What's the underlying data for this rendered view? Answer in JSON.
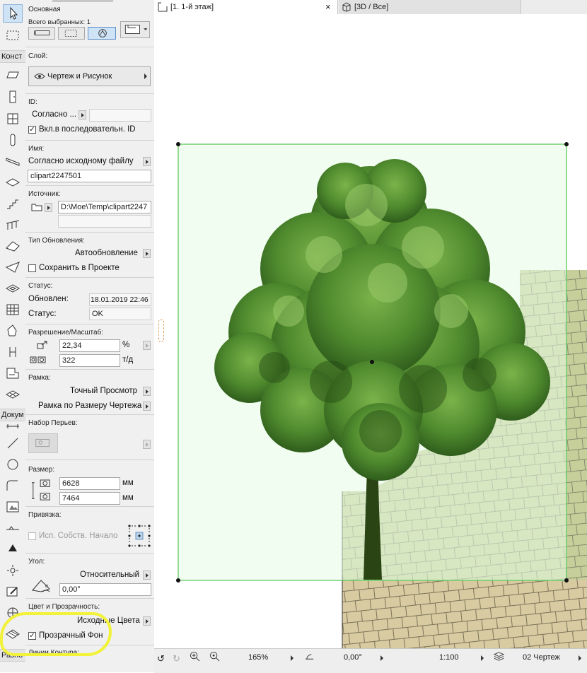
{
  "toolbox": {
    "header_construct": "Конст",
    "header_document": "Докум",
    "header_misc": "Разно"
  },
  "panel": {
    "main_label": "Основная",
    "selected_count": "Всего выбранных: 1",
    "layer": {
      "label": "Слой:",
      "value": "Чертеж и Рисунок"
    },
    "id": {
      "label": "ID:",
      "mode": "Согласно ...",
      "value": "",
      "sequential_label": "Вкл.в последовательн. ID",
      "sequential_checked": true
    },
    "name": {
      "label": "Имя:",
      "mode": "Согласно исходному файлу",
      "value": "clipart2247501"
    },
    "source": {
      "label": "Источник:",
      "path": "D:\\Moe\\Temp\\clipart2247"
    },
    "update": {
      "label": "Тип Обновления:",
      "mode": "Автообновление",
      "save_label": "Сохранить в Проекте",
      "save_checked": false
    },
    "status": {
      "label": "Статус:",
      "updated_label": "Обновлен:",
      "updated_value": "18.01.2019 22:46",
      "status_label": "Статус:",
      "status_value": "OK"
    },
    "resolution": {
      "label": "Разрешение/Масштаб:",
      "percent": "22,34",
      "percent_unit": "%",
      "dpi": "322",
      "dpi_unit": "т/д"
    },
    "frame": {
      "label": "Рамка:",
      "view": "Точный Просмотр",
      "fit": "Рамка по Размеру Чертежа"
    },
    "pen_set": {
      "label": "Набор Перьев:"
    },
    "size": {
      "label": "Размер:",
      "width": "6628",
      "width_unit": "мм",
      "height": "7464",
      "height_unit": "мм"
    },
    "anchor": {
      "label": "Привязка:",
      "origin_label": "Исп. Собств. Начало",
      "origin_checked": false
    },
    "angle": {
      "label": "Угол:",
      "mode": "Относительный",
      "value": "0,00°"
    },
    "color": {
      "label": "Цвет и Прозрачность:",
      "mode": "Исходные Цвета",
      "transparent_label": "Прозрачный Фон",
      "transparent_checked": true
    },
    "outline": {
      "label": "Линии Контура:"
    }
  },
  "tabs": [
    {
      "label": "[1. 1-й этаж]",
      "close": "×"
    },
    {
      "label": "[3D / Все]"
    }
  ],
  "statusbar": {
    "zoom": "165%",
    "angle": "0,00°",
    "scale": "1:100",
    "layer_combo": "02 Чертеж"
  },
  "colors": {
    "selection": "#66cc66",
    "selection_fill": "#e6fbe4",
    "tile_green": "#c6cf9a",
    "tile_beige": "#d8cba1",
    "highlight": "#f2f238"
  }
}
